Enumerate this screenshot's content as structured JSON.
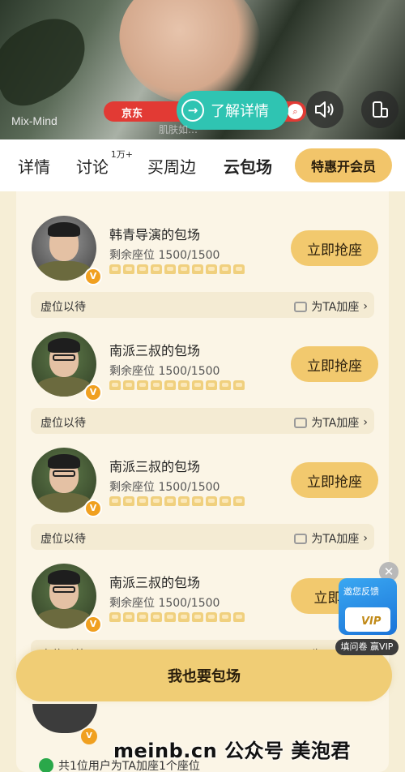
{
  "video": {
    "watermark": "Mix-Mind",
    "caption": "肌肤如…",
    "ad_brand": "京东",
    "learn_more_label": "了解详情"
  },
  "tabs": [
    {
      "label": "详情",
      "active": false
    },
    {
      "label": "讨论",
      "badge": "1万+",
      "active": false
    },
    {
      "label": "买周边",
      "active": false
    },
    {
      "label": "云包场",
      "active": true
    }
  ],
  "vip_button": "特惠开会员",
  "cards": [
    {
      "name": "韩青导演的包场",
      "seats": "剩余座位 1500/1500",
      "action": "立即抢座",
      "wait": "虚位以待",
      "add_seat": "为TA加座",
      "avatar": "gray"
    },
    {
      "name": "南派三叔的包场",
      "seats": "剩余座位 1500/1500",
      "action": "立即抢座",
      "wait": "虚位以待",
      "add_seat": "为TA加座",
      "avatar": "green"
    },
    {
      "name": "南派三叔的包场",
      "seats": "剩余座位 1500/1500",
      "action": "立即抢座",
      "wait": "虚位以待",
      "add_seat": "为TA加座",
      "avatar": "green"
    },
    {
      "name": "南派三叔的包场",
      "seats": "剩余座位 1500/1500",
      "action": "立即抢",
      "wait": "虚位以待",
      "add_seat": "为TA加座",
      "avatar": "green"
    }
  ],
  "seat_icon_count": 10,
  "badge_letter": "V",
  "bottom": {
    "button_label": "我也要包场",
    "note": "共1位用户为TA加座1个座位",
    "site_mark": "meinb.cn  公众号 美泡君"
  },
  "feedback": {
    "title": "邀您反馈",
    "vip": "VIP",
    "survey": "填问卷 赢VIP"
  }
}
